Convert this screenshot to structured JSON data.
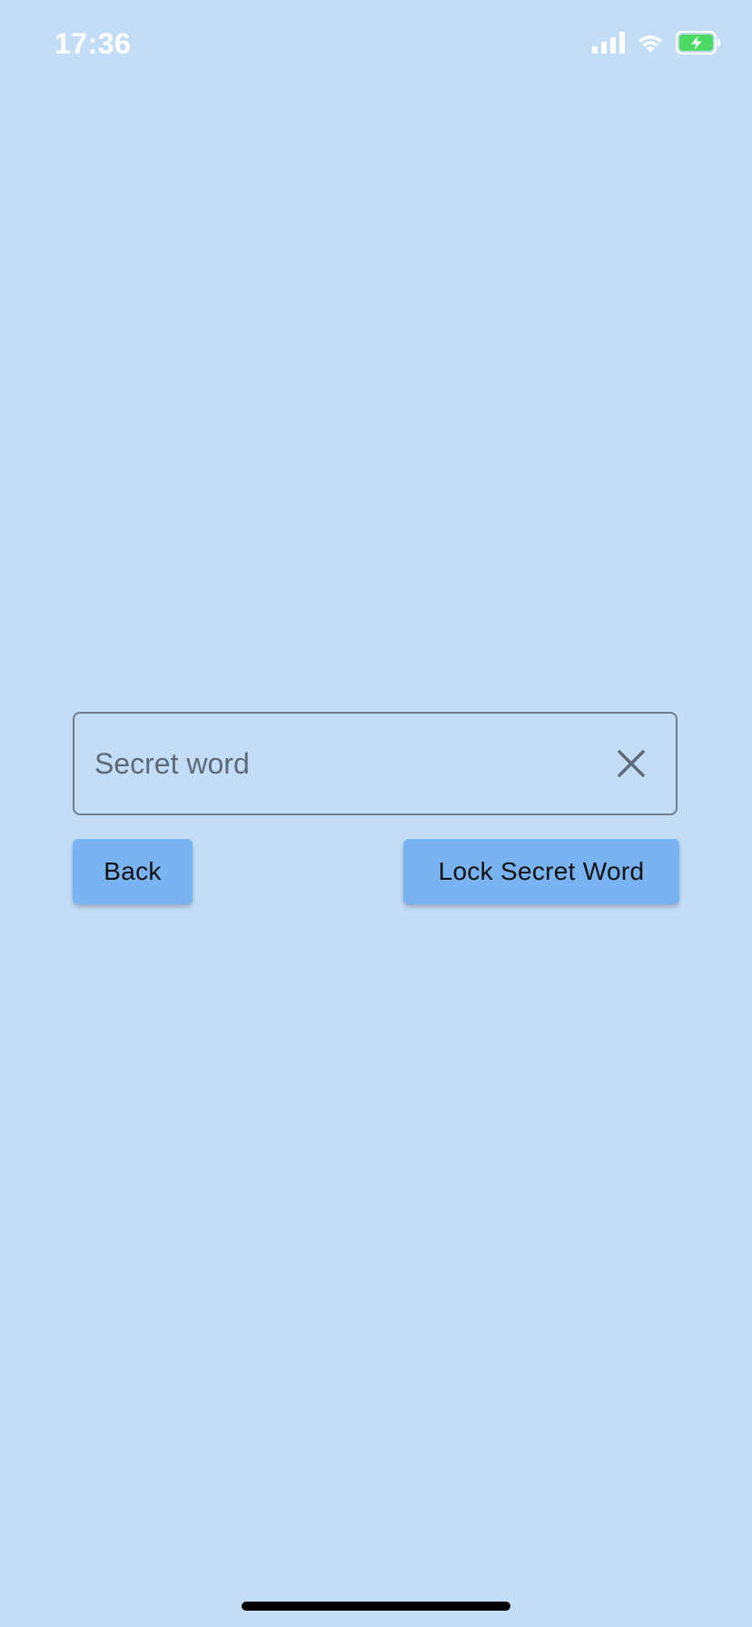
{
  "status_bar": {
    "time": "17:36",
    "icons": [
      "cellular-signal-icon",
      "wifi-icon",
      "battery-charging-icon"
    ]
  },
  "form": {
    "secret_word_field": {
      "placeholder": "Secret word",
      "value": ""
    },
    "clear_icon": "close-icon"
  },
  "buttons": {
    "back_label": "Back",
    "lock_label": "Lock Secret Word"
  },
  "colors": {
    "background": "#c3ddf7",
    "button": "#7ab3f1",
    "field_border": "#6f7f8f",
    "battery_fill": "#4cd964"
  }
}
